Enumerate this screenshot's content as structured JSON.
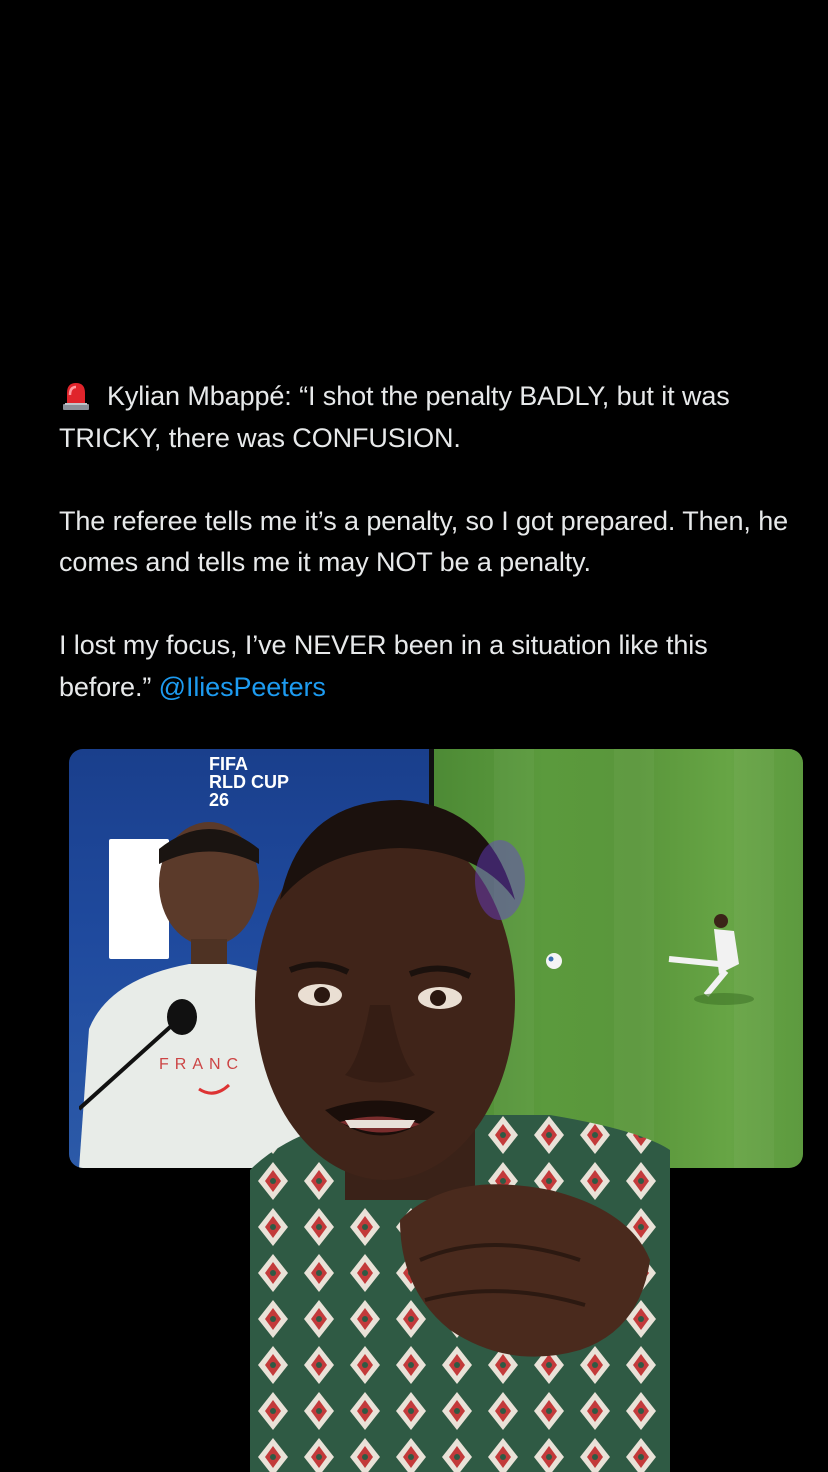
{
  "tweet": {
    "icon": "police-siren-emoji",
    "line1_rest": "Kylian Mbappé: “I shot the penalty BADLY, but it was TRICKY, there was CONFUSION.",
    "para2": "The referee tells me it’s a penalty, so I got prepared. Then, he comes and tells me it may NOT be a penalty.",
    "para3": "I lost my focus, I’ve NEVER been in a situation like this before.”",
    "mention": "@IliesPeeters"
  },
  "media": {
    "left_banner_line1": "FIFA",
    "left_banner_line2": "RLD CUP",
    "left_banner_line3": "26",
    "shirt_text": "FRANC"
  },
  "colors": {
    "background": "#000000",
    "text": "#e7e9ea",
    "mention": "#1d9bf0",
    "pitch": "#5a963b",
    "backdrop": "#1f4a9e"
  }
}
